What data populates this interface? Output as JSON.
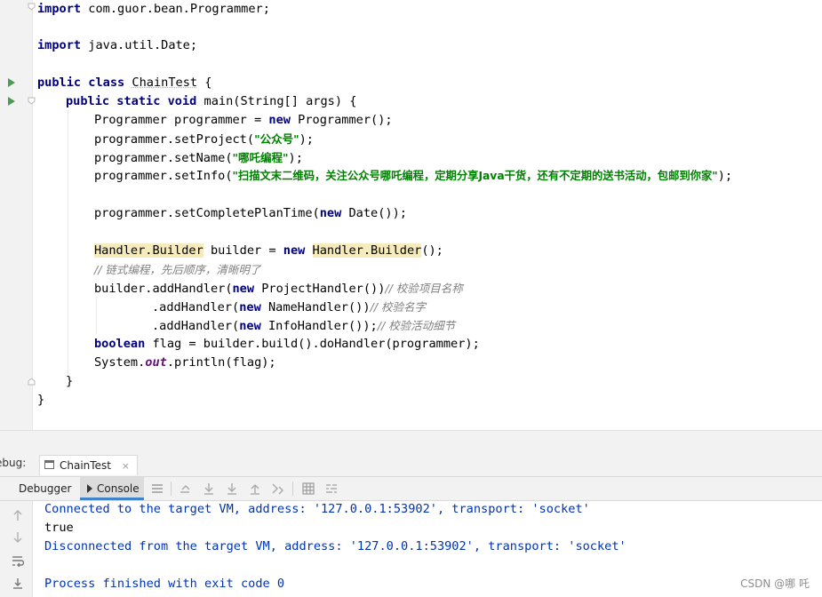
{
  "editor": {
    "lines": {
      "l1": {
        "k": "import",
        "rest": " com.guor.bean.Programmer;"
      },
      "l3": {
        "k": "import",
        "rest": " java.util.Date;"
      },
      "l5": {
        "k1": "public",
        "k2": "class",
        "name": "ChainTest",
        "rest": " {"
      },
      "l6": {
        "k1": "public",
        "k2": "static",
        "k3": "void",
        "rest": " main(String[] args) {"
      },
      "l7": {
        "a": "Programmer programmer = ",
        "k": "new",
        "b": " Programmer();"
      },
      "l8": {
        "a": "programmer.setProject(",
        "s": "\"公众号\"",
        "b": ");"
      },
      "l9": {
        "a": "programmer.setName(",
        "s": "\"哪吒编程\"",
        "b": ");"
      },
      "l10": {
        "a": "programmer.setInfo(",
        "s": "\"扫描文末二维码，关注公众号哪吒编程，定期分享Java干货，还有不定期的送书活动，包邮到你家\"",
        "b": ");"
      },
      "l12": {
        "a": "programmer.setCompletePlanTime(",
        "k": "new",
        "b": " Date());"
      },
      "l14": {
        "t1": "Handler.Builder",
        "a": " builder = ",
        "k": "new",
        "b": " ",
        "t2": "Handler.Builder",
        "c": "();"
      },
      "l15": {
        "cm": "// 链式编程，先后顺序，清晰明了"
      },
      "l16": {
        "a": "builder.addHandler(",
        "k": "new",
        "b": " ProjectHandler())",
        "cm": "// 校验项目名称"
      },
      "l17": {
        "a": ".addHandler(",
        "k": "new",
        "b": " NameHandler())",
        "cm": "// 校验名字"
      },
      "l18": {
        "a": ".addHandler(",
        "k": "new",
        "b": " InfoHandler());",
        "cm": "// 校验活动细节"
      },
      "l19": {
        "k": "boolean",
        "a": " flag = builder.build().doHandler(programmer);"
      },
      "l20": {
        "a": "System.",
        "f": "out",
        "b": ".println(flag);"
      },
      "l21": {
        "a": "}"
      },
      "l22": {
        "a": "}"
      }
    }
  },
  "debug": {
    "label": "ebug:",
    "run_tab": "ChainTest",
    "run_tab_close": "×",
    "tabs": {
      "debugger": "Debugger",
      "console": "Console"
    }
  },
  "console": {
    "lines": [
      "Connected to the target VM, address: '127.0.0.1:53902', transport: 'socket'",
      "true",
      "Disconnected from the target VM, address: '127.0.0.1:53902', transport: 'socket'",
      "",
      "Process finished with exit code 0"
    ]
  },
  "watermark": "CSDN @哪 吒",
  "colors": {
    "keyword": "#000080",
    "string": "#008000",
    "comment": "#808080",
    "console_system": "#0033b3",
    "highlight": "#f6ebbc",
    "active_tab_underline": "#4083c9"
  }
}
